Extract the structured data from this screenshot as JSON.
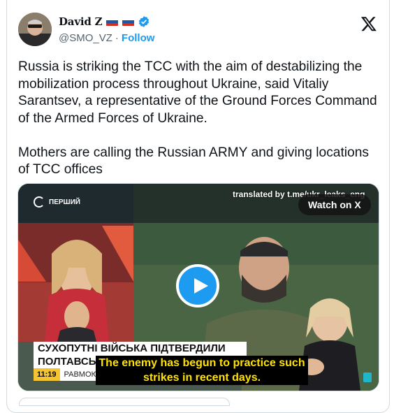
{
  "author": {
    "display_name": "David Z",
    "handle": "@SMO_VZ",
    "separator": "·",
    "follow_label": "Follow"
  },
  "tweet": {
    "text": "Russia is striking the TCC with the aim of destabilizing the mobilization process throughout Ukraine, said Vitaliy Sarantsev, a representative of the Ground Forces Command of the Armed Forces of Ukraine.\n\nMothers are calling the Russian ARMY and giving locations of TCC offices"
  },
  "media": {
    "watermark": "translated by t.me/ukr_leaks_eng",
    "watch_label": "Watch on X",
    "channel_name": "ПЕРШИЙ",
    "headline_line1": "СУХОПУТНІ ВІЙСЬКА ПІДТВЕРДИЛИ УДАР ПО",
    "headline_line2": "ПОЛТАВСЬКО",
    "clock": "11:19",
    "ticker": "РАВМОЮ.",
    "subtitle": "The enemy has begun to practice such strikes in recent days."
  },
  "icons": {
    "verified": "verified-badge-icon",
    "x_logo": "x-logo-icon",
    "play": "play-icon",
    "flags": "russian-flag-icon"
  },
  "colors": {
    "accent": "#1d9bf0",
    "text": "#0f1419",
    "muted": "#536471",
    "subtitle": "#ffe200"
  }
}
